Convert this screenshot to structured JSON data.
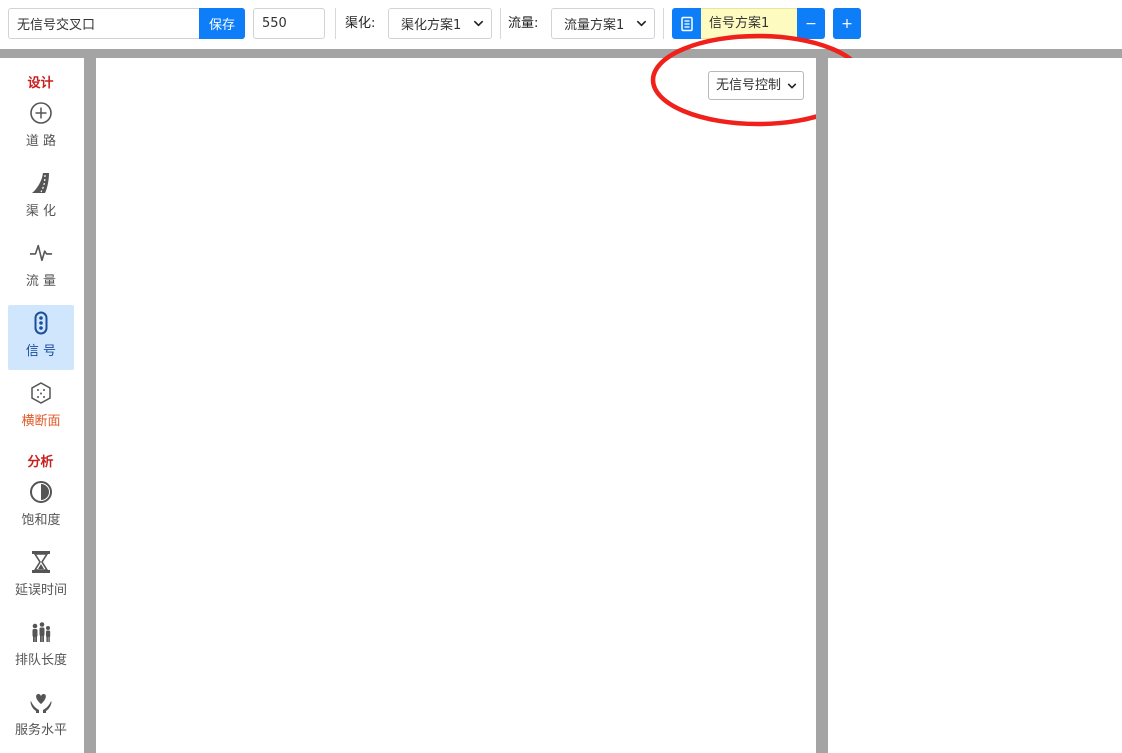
{
  "toolbar": {
    "intersection_name": "无信号交叉口",
    "save_label": "保存",
    "number_value": "550",
    "channelization_label": "渠化:",
    "channelization_value": "渠化方案1",
    "flow_label": "流量:",
    "flow_value": "流量方案1",
    "signal_plan_value": "信号方案1",
    "minus_label": "−",
    "plus_label": "+"
  },
  "sidebar": {
    "design_title": "设计",
    "analysis_title": "分析",
    "items": [
      {
        "label": "道 路",
        "icon": "crosshair-icon"
      },
      {
        "label": "渠 化",
        "icon": "road-curve-icon"
      },
      {
        "label": "流 量",
        "icon": "pulse-icon"
      },
      {
        "label": "信 号",
        "icon": "traffic-light-icon",
        "active": true
      },
      {
        "label": "横断面",
        "icon": "cube-icon"
      },
      {
        "label": "饱和度",
        "icon": "half-circle-icon"
      },
      {
        "label": "延误时间",
        "icon": "hourglass-icon"
      },
      {
        "label": "排队长度",
        "icon": "people-icon"
      },
      {
        "label": "服务水平",
        "icon": "heart-hands-icon"
      }
    ]
  },
  "canvas": {
    "signal_control_value": "无信号控制"
  },
  "colors": {
    "accent": "#0d7ef8",
    "section_title": "#c81e1e",
    "active_bg": "#cfe6fd",
    "plan_bg": "#fdfbc0",
    "divider": "#a4a4a4",
    "callout": "#f0201a",
    "orange_label": "#e05a2a"
  }
}
